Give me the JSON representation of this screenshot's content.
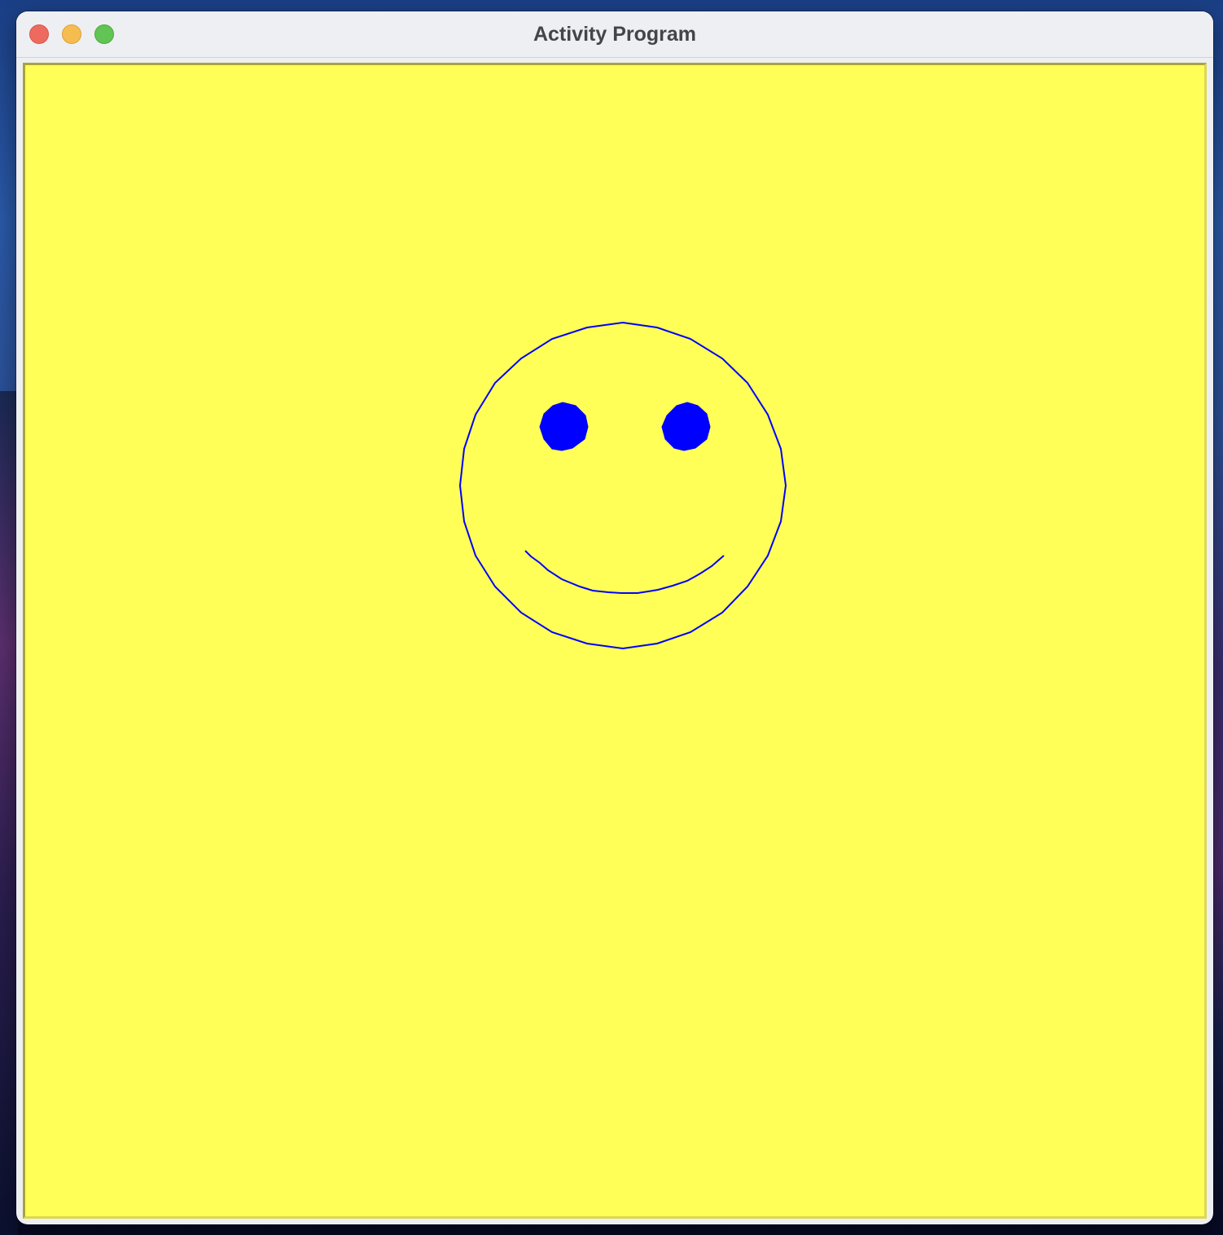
{
  "window": {
    "title": "Activity Program"
  },
  "canvas": {
    "background_color": "#ffff57",
    "stroke_color": "#0000ff",
    "shapes": [
      "face-outline",
      "left-eye",
      "right-eye",
      "smile"
    ]
  }
}
